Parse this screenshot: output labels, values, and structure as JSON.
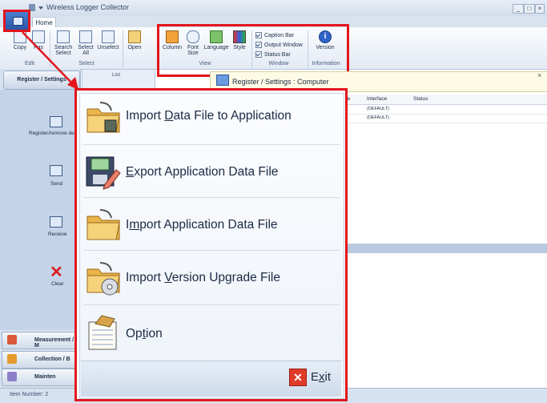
{
  "window": {
    "title": "Wireless Logger Collector",
    "min": "_",
    "max": "□",
    "close": "×"
  },
  "ribbon": {
    "tab_home": "Home",
    "buttons": {
      "copy": "Copy",
      "paste": "Pas",
      "search_select": "Search Select",
      "select_all": "Select All",
      "unselect": "Unselect",
      "open": "Open",
      "column": "Column",
      "font_size": "Font Size",
      "language": "Language",
      "style": "Style",
      "version": "Version"
    },
    "groups": {
      "edit": "Edit",
      "select": "Select",
      "view": "View",
      "window": "Window",
      "information": "Information"
    },
    "window_checks": [
      "Caption Bar",
      "Output Window",
      "Status Bar"
    ]
  },
  "sidebar": {
    "header": "Register / Settings",
    "items": [
      {
        "label": "Register/remove de",
        "icon": "device-register-icon"
      },
      {
        "label": "Send",
        "icon": "send-icon"
      },
      {
        "label": "Receive",
        "icon": "receive-icon"
      },
      {
        "label": "Clear",
        "icon": "clear-icon"
      }
    ],
    "nav": [
      {
        "label": "Measurement / M",
        "icon": "measurement-icon"
      },
      {
        "label": "Collection / B",
        "icon": "collection-icon"
      },
      {
        "label": "Mainten",
        "icon": "maintenance-icon"
      }
    ]
  },
  "main": {
    "list_label": "List",
    "register_bar": "Register / Settings : Computer",
    "grid_headers": [
      "ne",
      "Interface",
      "Status"
    ],
    "grid_rows": [
      [
        "",
        "(DEFAULT)",
        ""
      ],
      [
        "",
        "(DEFAULT)",
        ""
      ]
    ]
  },
  "app_menu": {
    "items": [
      {
        "pre": "Import ",
        "accel": "D",
        "post": "ata File to Application",
        "icon": "import-data-folder-icon"
      },
      {
        "pre": "",
        "accel": "E",
        "post": "xport Application Data File",
        "icon": "export-floppy-icon"
      },
      {
        "pre": "I",
        "accel": "m",
        "post": "port Application Data File",
        "icon": "import-folder-icon"
      },
      {
        "pre": "Import ",
        "accel": "V",
        "post": "ersion Upgrade File",
        "icon": "import-cd-folder-icon"
      },
      {
        "pre": "Op",
        "accel": "t",
        "post": "ion",
        "icon": "option-notepad-icon"
      }
    ],
    "exit": {
      "pre": "E",
      "accel": "x",
      "post": "it"
    }
  },
  "status": {
    "item_number": "Item Number: 2"
  },
  "colors": {
    "highlight": "#e3161d",
    "ribbon": "#e3eaf4",
    "sidebar": "#d7e2f0"
  }
}
